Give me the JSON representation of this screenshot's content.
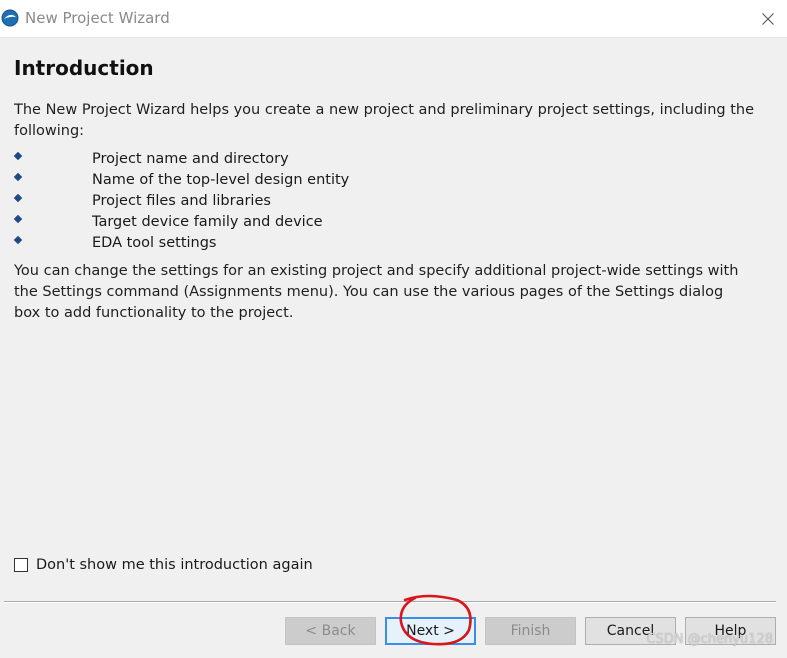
{
  "window": {
    "title": "New Project Wizard",
    "icon": "quartus-app-icon",
    "close_icon": "close-icon"
  },
  "page": {
    "heading": "Introduction",
    "intro": "The New Project Wizard helps you create a new project and preliminary project settings, including the following:",
    "bullets": [
      "Project name and directory",
      "Name of the top-level design entity",
      "Project files and libraries",
      "Target device family and device",
      "EDA tool settings"
    ],
    "outro": "You can change the settings for an existing project and specify additional project-wide settings with the Settings command (Assignments menu). You can use the various pages of the Settings dialog box to add functionality to the project."
  },
  "checkbox": {
    "label": "Don't show me this introduction again",
    "checked": false
  },
  "buttons": {
    "back": "< Back",
    "next": "Next >",
    "finish": "Finish",
    "cancel": "Cancel",
    "help": "Help"
  },
  "annotation": {
    "color": "#d9161c"
  },
  "watermark": "CSDN @chenyu128"
}
